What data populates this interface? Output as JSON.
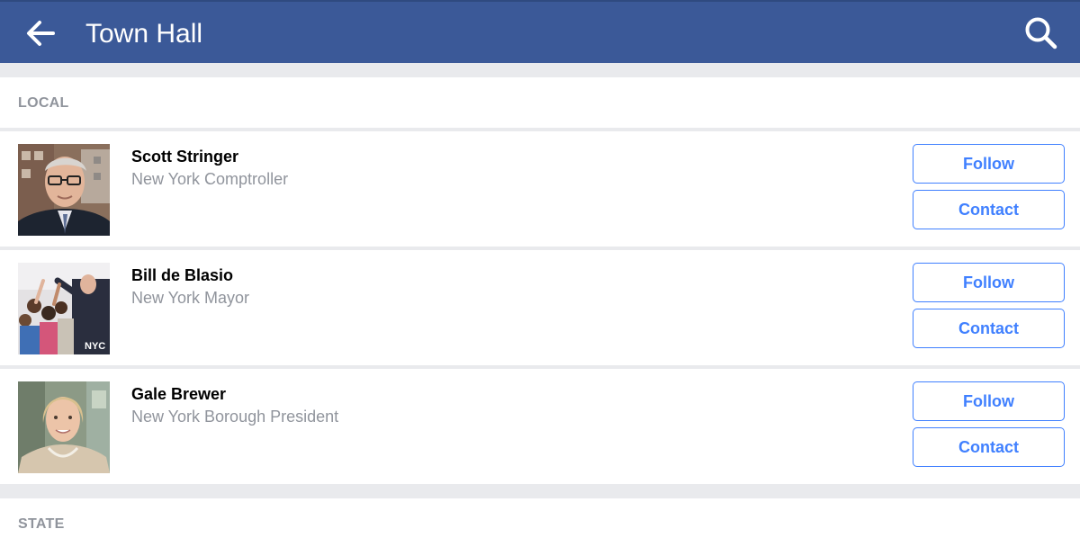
{
  "header": {
    "title": "Town Hall",
    "back_icon": "arrow-left-icon",
    "search_icon": "search-icon",
    "background": "#3b5998"
  },
  "sections": [
    {
      "label": "LOCAL",
      "officials": [
        {
          "name": "Scott Stringer",
          "role": "New York Comptroller",
          "follow_label": "Follow",
          "contact_label": "Contact"
        },
        {
          "name": "Bill de Blasio",
          "role": "New York Mayor",
          "follow_label": "Follow",
          "contact_label": "Contact",
          "photo_badge": "NYC"
        },
        {
          "name": "Gale Brewer",
          "role": "New York Borough President",
          "follow_label": "Follow",
          "contact_label": "Contact"
        }
      ]
    },
    {
      "label": "STATE",
      "officials": []
    }
  ],
  "colors": {
    "accent": "#4080ff",
    "secondary_text": "#90949c",
    "divider": "#e9eaed"
  }
}
